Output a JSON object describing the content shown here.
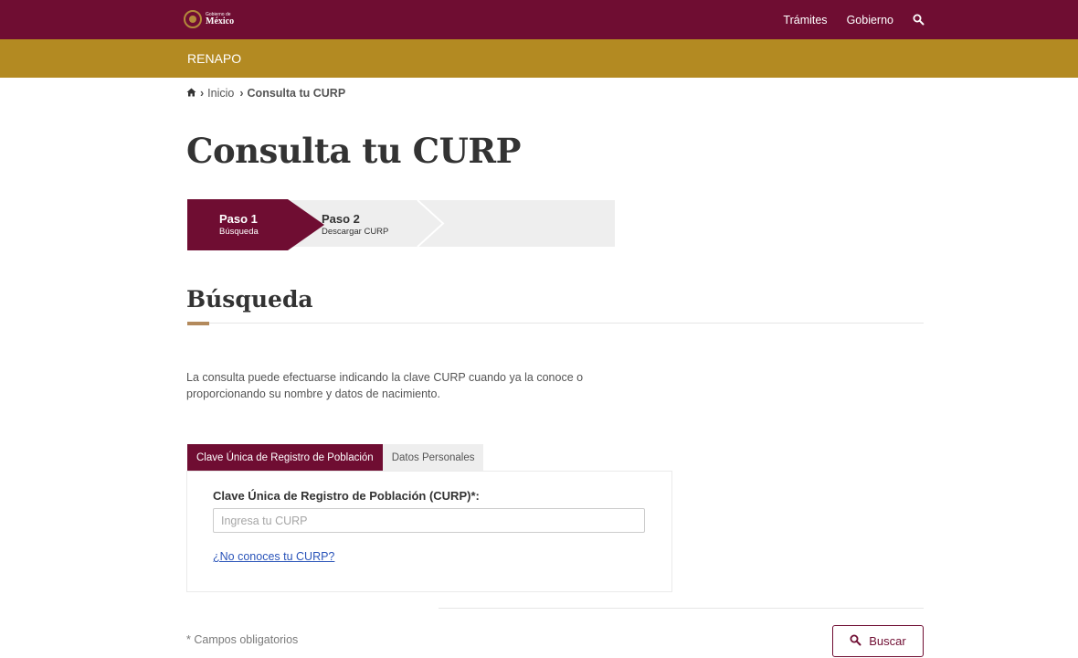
{
  "header": {
    "logo_small": "Gobierno de",
    "logo_big": "México",
    "nav": [
      {
        "label": "Trámites"
      },
      {
        "label": "Gobierno"
      }
    ],
    "search_icon": "search-icon"
  },
  "subheader": {
    "label": "RENAPO"
  },
  "breadcrumb": {
    "home_icon": "home-icon",
    "items": [
      {
        "label": "Inicio"
      },
      {
        "label": "Consulta tu CURP"
      }
    ]
  },
  "page": {
    "title": "Consulta tu CURP"
  },
  "steps": [
    {
      "number": "Paso 1",
      "label": "Búsqueda",
      "active": true
    },
    {
      "number": "Paso 2",
      "label": "Descargar CURP",
      "active": false
    }
  ],
  "section": {
    "title": "Búsqueda",
    "intro": "La consulta puede efectuarse indicando la clave CURP cuando ya la conoce o proporcionando su nombre y datos de nacimiento."
  },
  "tabs": [
    {
      "label": "Clave Única de Registro de Población",
      "active": true
    },
    {
      "label": "Datos Personales",
      "active": false
    }
  ],
  "form": {
    "field_label": "Clave Única de Registro de Población (CURP)*:",
    "input_value": "",
    "input_placeholder": "Ingresa tu CURP",
    "help_link": "¿No conoces tu CURP?"
  },
  "footer": {
    "required_note": "* Campos obligatorios",
    "search_button": "Buscar"
  },
  "colors": {
    "primary": "#6f0d32",
    "gold": "#b38a22",
    "accent_line": "#b38a5c",
    "link": "#2a54b9"
  }
}
